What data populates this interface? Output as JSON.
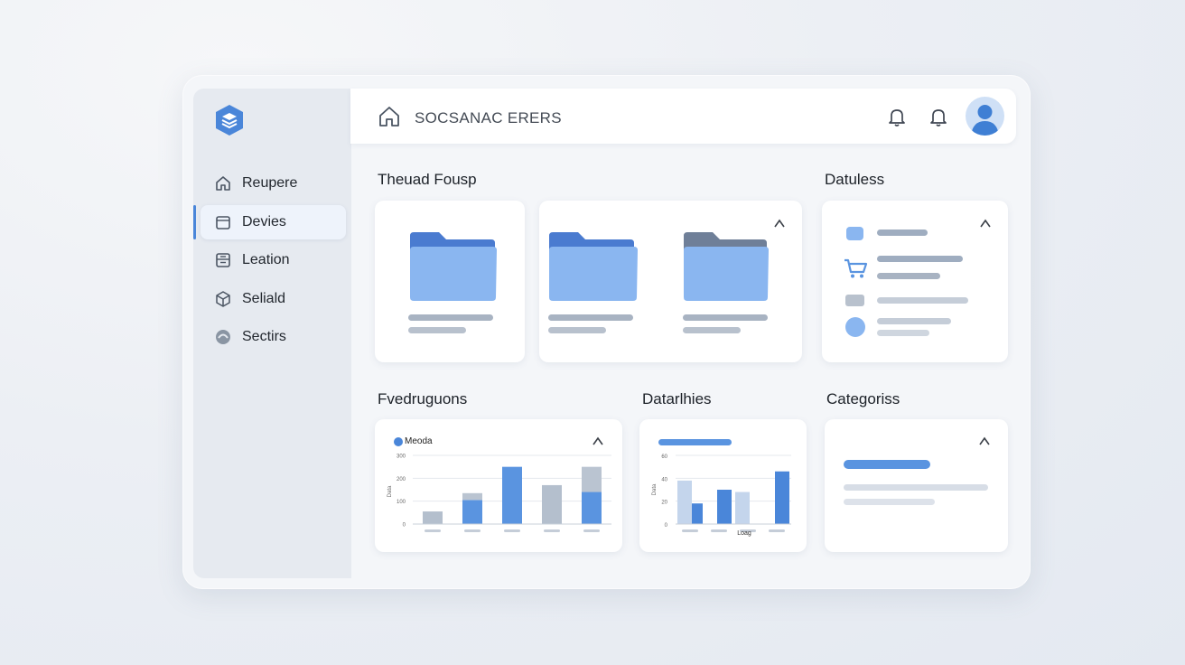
{
  "topbar": {
    "title": "SOCSANAC ERERS"
  },
  "sidebar": {
    "items": [
      {
        "label": "Reupere",
        "icon": "home-icon",
        "active": false
      },
      {
        "label": "Devies",
        "icon": "calendar-icon",
        "active": true
      },
      {
        "label": "Leation",
        "icon": "archive-icon",
        "active": false
      },
      {
        "label": "Seliald",
        "icon": "cube-icon",
        "active": false
      },
      {
        "label": "Sectirs",
        "icon": "circle-icon",
        "active": false
      }
    ]
  },
  "sections": {
    "folders": "Theuad Fousp",
    "details": "Datuless",
    "fvedruguons": "Fvedruguons",
    "datarlhies": "Datarlhies",
    "categories": "Categoriss"
  },
  "colors": {
    "accent": "#4a86d9",
    "folder_light": "#8ab6f0",
    "folder_dark": "#4a7bd0",
    "gray_bar": "#a8b3c2"
  },
  "chart_data": [
    {
      "type": "bar",
      "legend": [
        "Meoda"
      ],
      "yticks": [
        "0",
        "100",
        "200",
        "300"
      ],
      "ylabel": "Data",
      "categories": [
        "",
        "",
        "",
        "",
        ""
      ],
      "series": [
        {
          "name": "Meoda",
          "values": [
            0,
            105,
            250,
            0,
            140
          ]
        },
        {
          "values": [
            55,
            30,
            0,
            170,
            110
          ]
        }
      ]
    },
    {
      "type": "bar",
      "yticks": [
        "0",
        "20",
        "40",
        "60"
      ],
      "ylabel": "Data",
      "xlabel": "Loag",
      "categories": [
        "",
        "",
        "",
        ""
      ],
      "series": [
        {
          "values": [
            18,
            30,
            0,
            46
          ]
        },
        {
          "values": [
            38,
            0,
            28,
            0
          ]
        }
      ]
    }
  ]
}
